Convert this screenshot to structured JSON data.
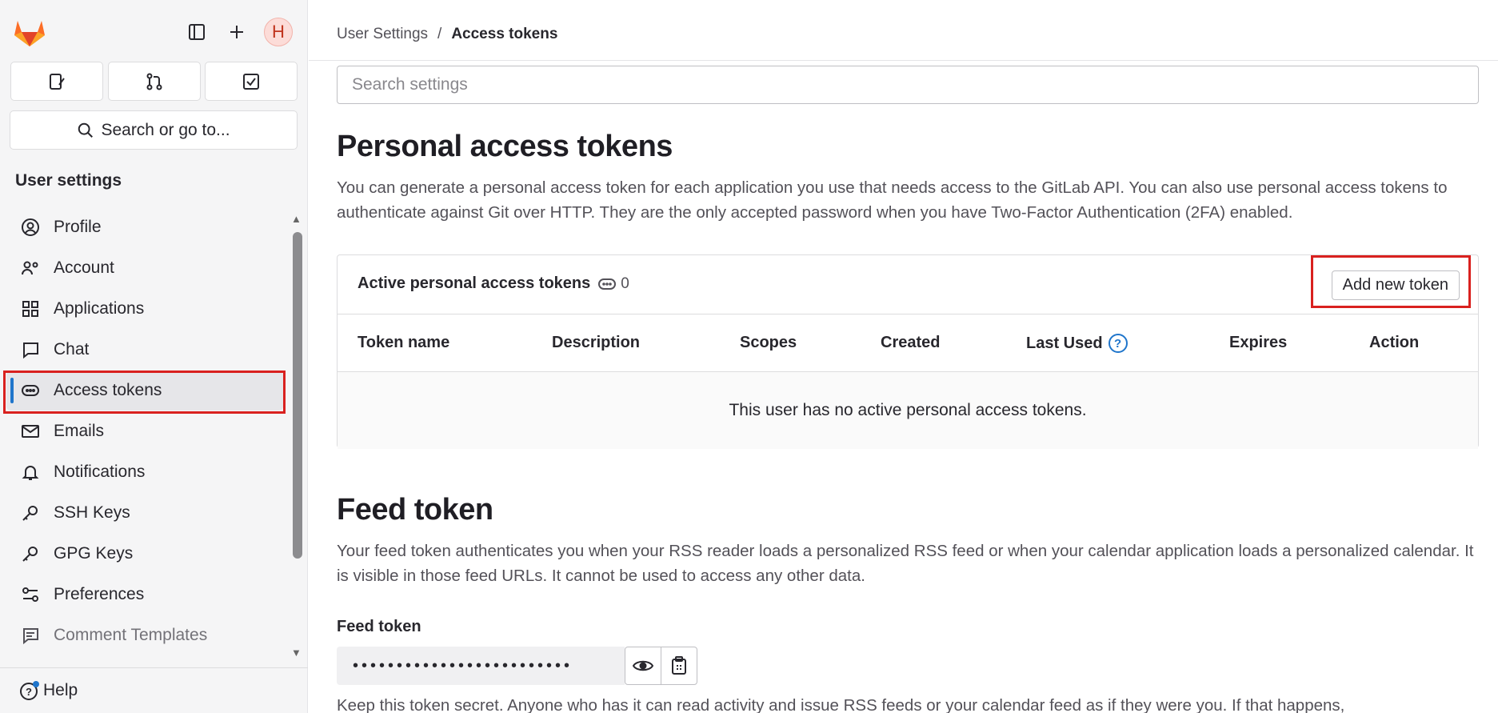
{
  "sidebar": {
    "section_title": "User settings",
    "search_label": "Search or go to...",
    "avatar_initial": "H",
    "items": [
      {
        "label": "Profile"
      },
      {
        "label": "Account"
      },
      {
        "label": "Applications"
      },
      {
        "label": "Chat"
      },
      {
        "label": "Access tokens"
      },
      {
        "label": "Emails"
      },
      {
        "label": "Notifications"
      },
      {
        "label": "SSH Keys"
      },
      {
        "label": "GPG Keys"
      },
      {
        "label": "Preferences"
      },
      {
        "label": "Comment Templates"
      }
    ],
    "help_label": "Help"
  },
  "breadcrumb": {
    "parent": "User Settings",
    "separator": "/",
    "current": "Access tokens"
  },
  "search": {
    "placeholder": "Search settings"
  },
  "pat": {
    "title": "Personal access tokens",
    "description": "You can generate a personal access token for each application you use that needs access to the GitLab API. You can also use personal access tokens to authenticate against Git over HTTP. They are the only accepted password when you have Two-Factor Authentication (2FA) enabled.",
    "card_title": "Active personal access tokens",
    "count": "0",
    "add_button": "Add new token",
    "columns": [
      "Token name",
      "Description",
      "Scopes",
      "Created",
      "Last Used",
      "Expires",
      "Action"
    ],
    "empty_message": "This user has no active personal access tokens."
  },
  "feed": {
    "title": "Feed token",
    "description": "Your feed token authenticates you when your RSS reader loads a personalized RSS feed or when your calendar application loads a personalized calendar. It is visible in those feed URLs. It cannot be used to access any other data.",
    "label": "Feed token",
    "masked_value": "•••••••••••••••••••••••••",
    "footer_text": "Keep this token secret. Anyone who has it can read activity and issue RSS feeds or your calendar feed as if they were you. If that happens,"
  },
  "colors": {
    "accent": "#1f75cb",
    "highlight": "#d9211f"
  }
}
